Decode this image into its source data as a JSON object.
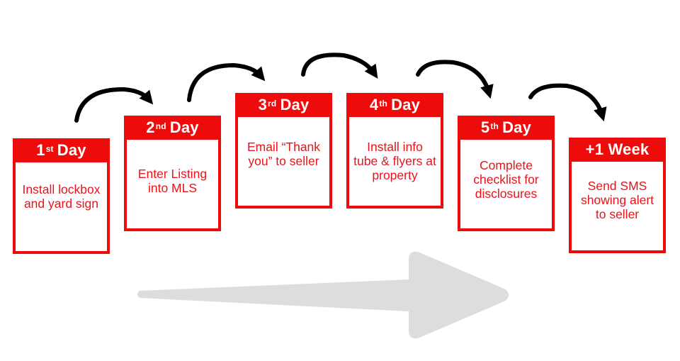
{
  "diagram": {
    "type": "process-timeline",
    "colors": {
      "accent": "#ee0b0b",
      "text": "#e8141b",
      "arrow": "#000000",
      "timeline_arrow": "#dddddd"
    },
    "steps": [
      {
        "num": "1",
        "suffix": "st",
        "unit": "Day",
        "text": "Install lockbox and yard sign"
      },
      {
        "num": "2",
        "suffix": "nd",
        "unit": "Day",
        "text": "Enter Listing into MLS"
      },
      {
        "num": "3",
        "suffix": "rd",
        "unit": "Day",
        "text": "Email “Thank you” to seller"
      },
      {
        "num": "4",
        "suffix": "th",
        "unit": "Day",
        "text": "Install info tube & flyers at property"
      },
      {
        "num": "5",
        "suffix": "th",
        "unit": "Day",
        "text": "Complete checklist for disclosures"
      },
      {
        "num": "+1 Week",
        "suffix": "",
        "unit": "",
        "text": "Send SMS showing alert to seller"
      }
    ],
    "connector_icons": [
      "curved-arrow-icon",
      "curved-arrow-icon",
      "curved-arrow-icon",
      "curved-arrow-icon",
      "curved-arrow-icon"
    ],
    "timeline_icon": "right-arrow-icon"
  }
}
